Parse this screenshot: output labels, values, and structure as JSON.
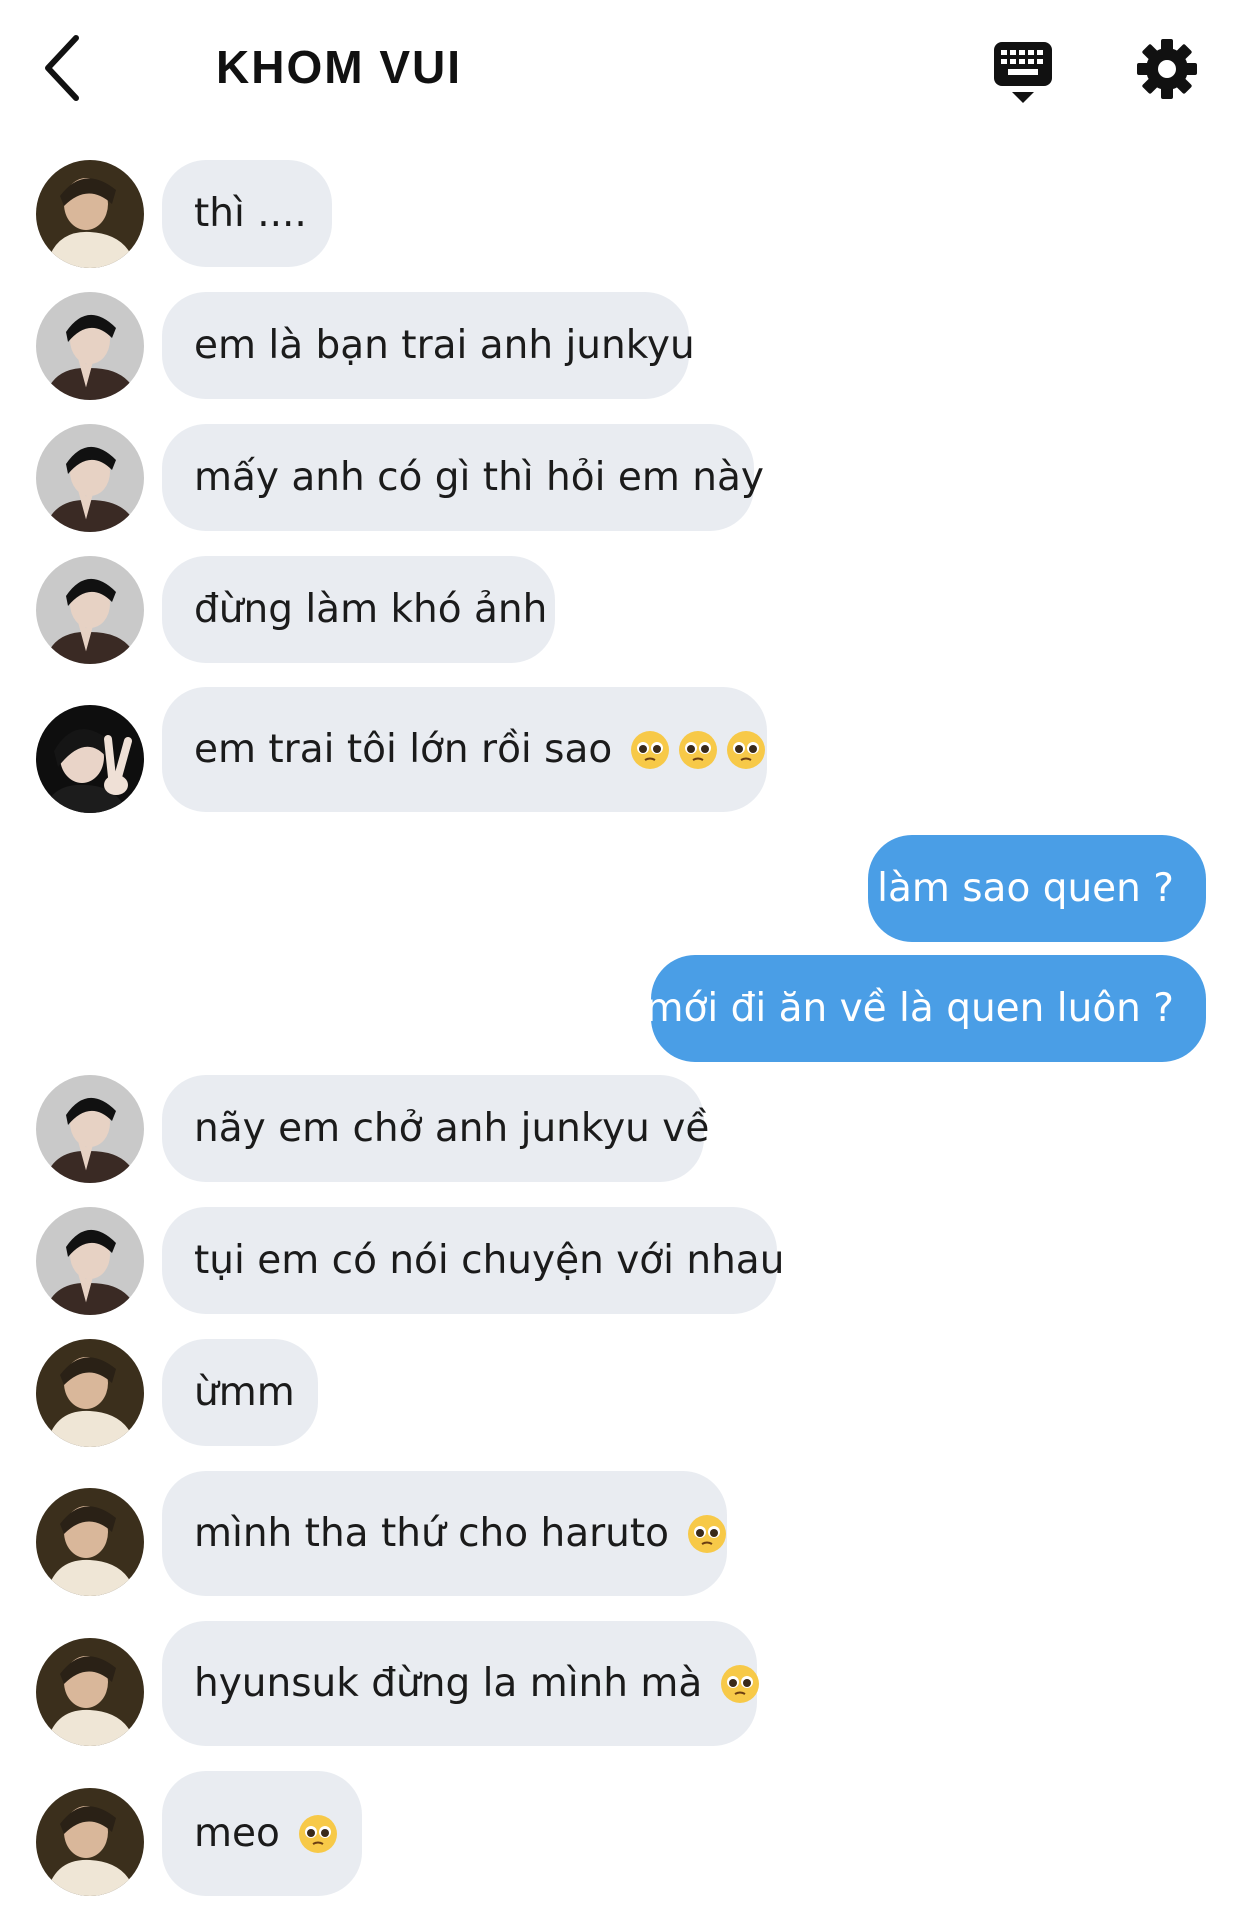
{
  "header": {
    "title": "KHOM VUI",
    "back_icon": "chevron-left-icon",
    "keyboard_icon": "keyboard-icon",
    "settings_icon": "gear-icon"
  },
  "colors": {
    "incoming_bubble": "#e9ecf1",
    "outgoing_bubble": "#4a9ee6"
  },
  "messages": [
    {
      "direction": "in",
      "avatar": "avatar-cream-sweater",
      "text": "thì ...."
    },
    {
      "direction": "in",
      "avatar": "avatar-dark-jacket",
      "text": "em là bạn trai anh junkyu"
    },
    {
      "direction": "in",
      "avatar": "avatar-dark-jacket",
      "text": "mấy anh có gì thì hỏi em này"
    },
    {
      "direction": "in",
      "avatar": "avatar-dark-jacket",
      "text": "đừng làm khó ảnh"
    },
    {
      "direction": "in",
      "avatar": "avatar-peace-sign",
      "text": "em trai tôi lớn rồi sao",
      "emoji_count": 3
    },
    {
      "direction": "out",
      "text": "làm sao quen ?"
    },
    {
      "direction": "out",
      "text": "mới đi ăn về là quen luôn ?"
    },
    {
      "direction": "in",
      "avatar": "avatar-dark-jacket",
      "text": "nãy em chở anh junkyu về"
    },
    {
      "direction": "in",
      "avatar": "avatar-dark-jacket",
      "text": "tụi em có nói chuyện với nhau"
    },
    {
      "direction": "in",
      "avatar": "avatar-cream-sweater",
      "text": "ừmm"
    },
    {
      "direction": "in",
      "avatar": "avatar-cream-sweater",
      "text": "mình tha thứ cho haruto",
      "emoji_count": 1
    },
    {
      "direction": "in",
      "avatar": "avatar-cream-sweater",
      "text": "hyunsuk đừng la mình mà",
      "emoji_count": 1
    },
    {
      "direction": "in",
      "avatar": "avatar-cream-sweater",
      "text": "meo",
      "emoji_count": 1
    }
  ]
}
